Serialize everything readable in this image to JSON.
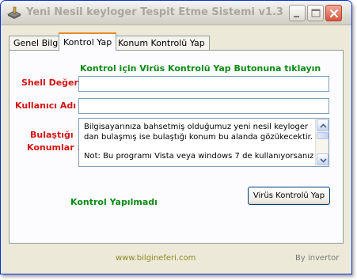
{
  "window": {
    "title": "Yeni Nesil keyloger Tespit Etme Sistemi v1.3"
  },
  "title_buttons": {
    "minimize_icon": "minimize-icon",
    "maximize_icon": "maximize-icon",
    "close_icon": "close-icon"
  },
  "tabs": [
    {
      "label": "Genel Bilgi",
      "active": false
    },
    {
      "label": "Kontrol Yap",
      "active": true
    },
    {
      "label": "Konum Kontrolü Yap",
      "active": false
    }
  ],
  "content": {
    "instruction": "Kontrol  için Virüs Kontrolü Yap Butonuna tıklayın",
    "shell_label": "Shell Değeri :",
    "shell_value": "",
    "user_label": "Kullanıcı Adı :",
    "user_value": "",
    "infected_label_line1": "Bulaştığı",
    "infected_label_line2": "Konumlar :",
    "infected_text_line1": "Bilgisayarınıza bahsetmiş olduğumuz  yeni nesil keyloger",
    "infected_text_line2": "dan bulaşmış ise bulaştığı konum bu alanda gözükecektir.",
    "infected_text_line3": "Not: Bu programı  Vista veya windows 7 de kullanıyorsanız",
    "status": "Kontrol Yapılmadı",
    "check_button": "Virüs Kontrolü Yap"
  },
  "footer": {
    "link": "www.bilgineferi.com",
    "author": "By invertor"
  },
  "colors": {
    "label_red": "#d41414",
    "info_green": "#0b8a16",
    "link_olive": "#8b8a25",
    "tab_active_accent": "#e68b2c"
  }
}
